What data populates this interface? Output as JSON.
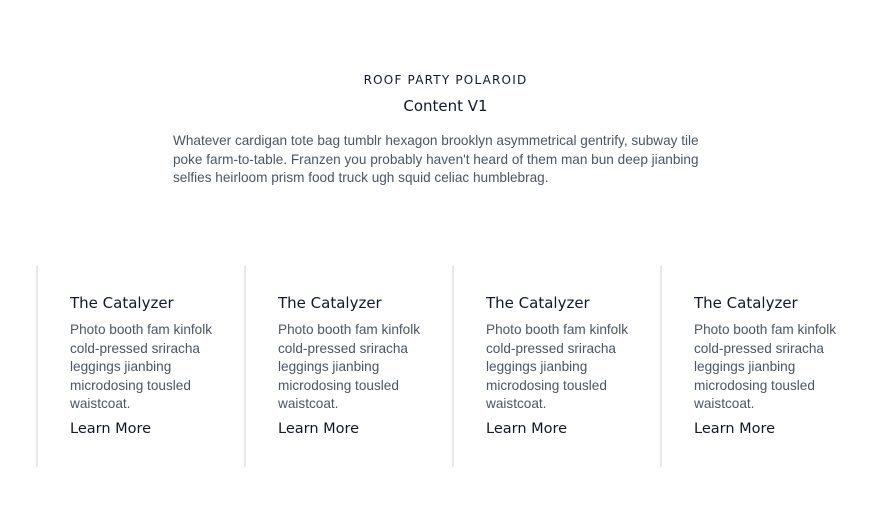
{
  "header": {
    "eyebrow": "ROOF PARTY POLAROID",
    "title": "Content V1",
    "description": "Whatever cardigan tote bag tumblr hexagon brooklyn asymmetrical gentrify, subway tile poke farm-to-table. Franzen you probably haven't heard of them man bun deep jianbing selfies heirloom prism food truck ugh squid celiac humblebrag."
  },
  "cards": [
    {
      "title": "The Catalyzer",
      "text": "Photo booth fam kinfolk cold-pressed sriracha leggings jianbing microdosing tousled waistcoat.",
      "link": "Learn More"
    },
    {
      "title": "The Catalyzer",
      "text": "Photo booth fam kinfolk cold-pressed sriracha leggings jianbing microdosing tousled waistcoat.",
      "link": "Learn More"
    },
    {
      "title": "The Catalyzer",
      "text": "Photo booth fam kinfolk cold-pressed sriracha leggings jianbing microdosing tousled waistcoat.",
      "link": "Learn More"
    },
    {
      "title": "The Catalyzer",
      "text": "Photo booth fam kinfolk cold-pressed sriracha leggings jianbing microdosing tousled waistcoat.",
      "link": "Learn More"
    }
  ]
}
